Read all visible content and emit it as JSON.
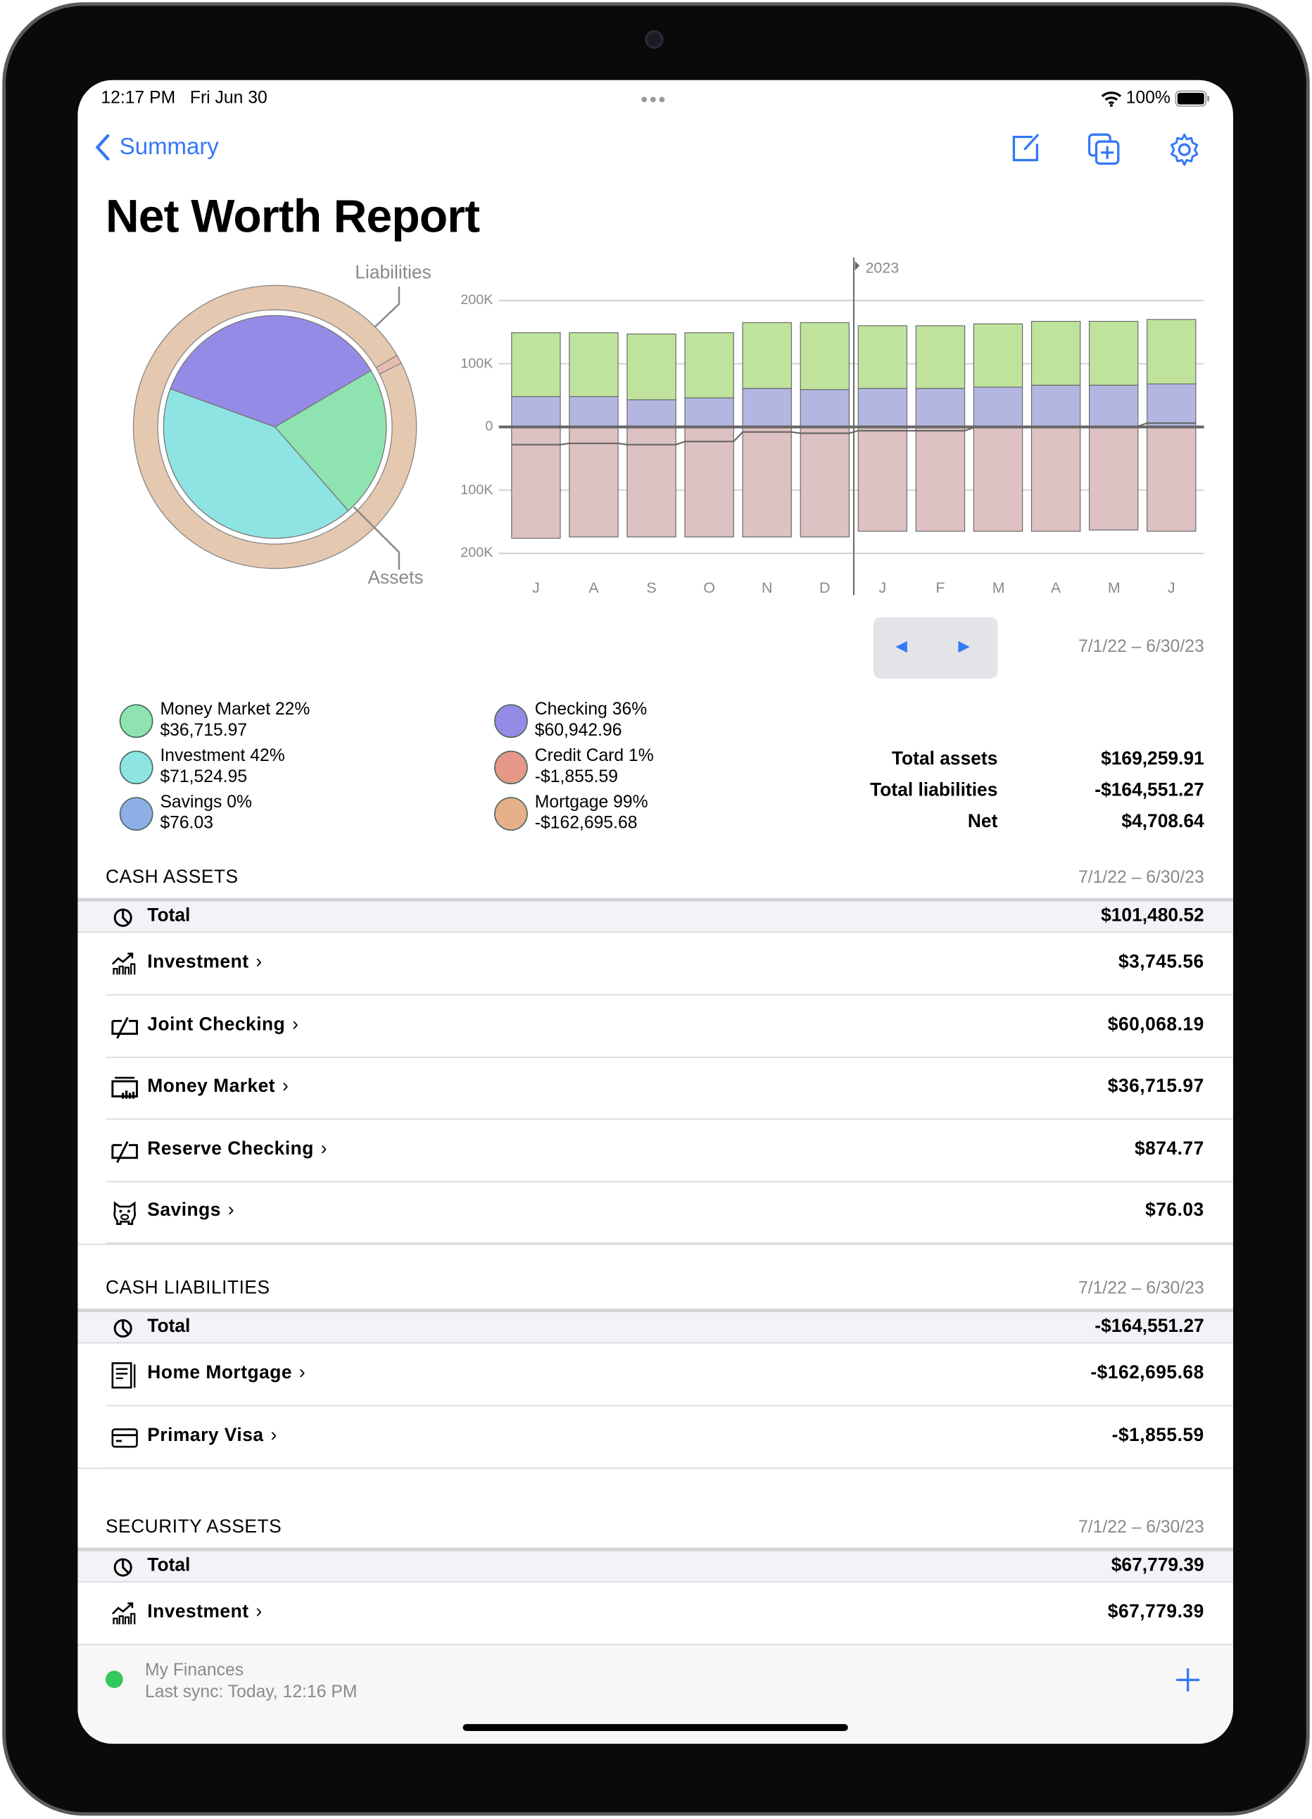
{
  "status_bar": {
    "time": "12:17 PM",
    "date": "Fri Jun 30",
    "battery": "100%"
  },
  "nav": {
    "back_label": "Summary",
    "icons": [
      "compose-icon",
      "duplicate-add-icon",
      "gear-icon"
    ]
  },
  "title": "Net Worth Report",
  "colors": {
    "accent": "#3478f6",
    "money_market": "#8ee3b0",
    "investment": "#8ee4e3",
    "savings": "#8eaee6",
    "checking": "#948be6",
    "credit_card": "#e59888",
    "mortgage": "#e6b08a",
    "bar_assets_other": "#bfe39c",
    "bar_checking": "#b4b6e2",
    "bar_liabilities": "#dec1c2"
  },
  "chart_data": [
    {
      "type": "pie",
      "title": "",
      "labels": {
        "outer": "Liabilities",
        "inner": "Assets"
      },
      "inner_ring": [
        {
          "name": "Checking",
          "percent": 36
        },
        {
          "name": "Money Market",
          "percent": 22
        },
        {
          "name": "Investment",
          "percent": 42
        },
        {
          "name": "Savings",
          "percent": 0
        }
      ],
      "outer_ring": [
        {
          "name": "Credit Card",
          "percent": 1
        },
        {
          "name": "Mortgage",
          "percent": 99
        }
      ]
    },
    {
      "type": "bar",
      "stacked": true,
      "title": "",
      "year_marker": "2023",
      "categories": [
        "J",
        "A",
        "S",
        "O",
        "N",
        "D",
        "J",
        "F",
        "M",
        "A",
        "M",
        "J"
      ],
      "y_ticks": [
        "200K",
        "100K",
        "0",
        "100K",
        "200K"
      ],
      "ylim": [
        -200000,
        200000
      ],
      "grid": true,
      "series": [
        {
          "values": [
            48000,
            48000,
            43000,
            46000,
            61000,
            59000,
            61000,
            61000,
            63000,
            66000,
            66000,
            68000
          ]
        },
        {
          "values": [
            101000,
            101000,
            104000,
            103000,
            104000,
            106000,
            99000,
            99000,
            100000,
            101000,
            101000,
            102000
          ]
        },
        {
          "values": [
            -176000,
            -174000,
            -174000,
            -174000,
            -174000,
            -174000,
            -165000,
            -165000,
            -165000,
            -165000,
            -163000,
            -165000
          ]
        }
      ],
      "net_line": [
        -28000,
        -26000,
        -28000,
        -23000,
        -8000,
        -10000,
        -6000,
        -6000,
        -1000,
        1000,
        1000,
        6000
      ]
    }
  ],
  "period": "7/1/22 – 6/30/23",
  "legend": [
    {
      "label": "Money Market 22%",
      "value": "$36,715.97",
      "color": "#8ee3b0"
    },
    {
      "label": "Investment 42%",
      "value": "$71,524.95",
      "color": "#8ee4e3"
    },
    {
      "label": "Savings 0%",
      "value": "$76.03",
      "color": "#8eaee6"
    },
    {
      "label": "Checking 36%",
      "value": "$60,942.96",
      "color": "#948be6"
    },
    {
      "label": "Credit Card 1%",
      "value": "-$1,855.59",
      "color": "#e59888"
    },
    {
      "label": "Mortgage 99%",
      "value": "-$162,695.68",
      "color": "#e6b08a"
    }
  ],
  "totals": {
    "assets_label": "Total assets",
    "assets": "$169,259.91",
    "liabilities_label": "Total liabilities",
    "liabilities": "-$164,551.27",
    "net_label": "Net",
    "net": "$4,708.64"
  },
  "sections": [
    {
      "title": "CASH ASSETS",
      "period": "7/1/22 – 6/30/23",
      "total_label": "Total",
      "total": "$101,480.52",
      "rows": [
        {
          "name": "Investment",
          "value": "$3,745.56",
          "icon": "chart-up-icon"
        },
        {
          "name": "Joint Checking",
          "value": "$60,068.19",
          "icon": "checkbook-icon"
        },
        {
          "name": "Money Market",
          "value": "$36,715.97",
          "icon": "money-market-icon"
        },
        {
          "name": "Reserve Checking",
          "value": "$874.77",
          "icon": "checkbook-icon"
        },
        {
          "name": "Savings",
          "value": "$76.03",
          "icon": "piggy-bank-icon"
        }
      ]
    },
    {
      "title": "CASH LIABILITIES",
      "period": "7/1/22 – 6/30/23",
      "total_label": "Total",
      "total": "-$164,551.27",
      "rows": [
        {
          "name": "Home Mortgage",
          "value": "-$162,695.68",
          "icon": "mortgage-document-icon"
        },
        {
          "name": "Primary Visa",
          "value": "-$1,855.59",
          "icon": "credit-card-icon"
        }
      ]
    },
    {
      "title": "SECURITY ASSETS",
      "period": "7/1/22 – 6/30/23",
      "total_label": "Total",
      "total": "$67,779.39",
      "rows": [
        {
          "name": "Investment",
          "value": "$67,779.39",
          "icon": "chart-up-icon"
        }
      ]
    }
  ],
  "footer": {
    "account": "My Finances",
    "sync": "Last sync: Today, 12:16 PM",
    "status_color": "#34c759"
  }
}
